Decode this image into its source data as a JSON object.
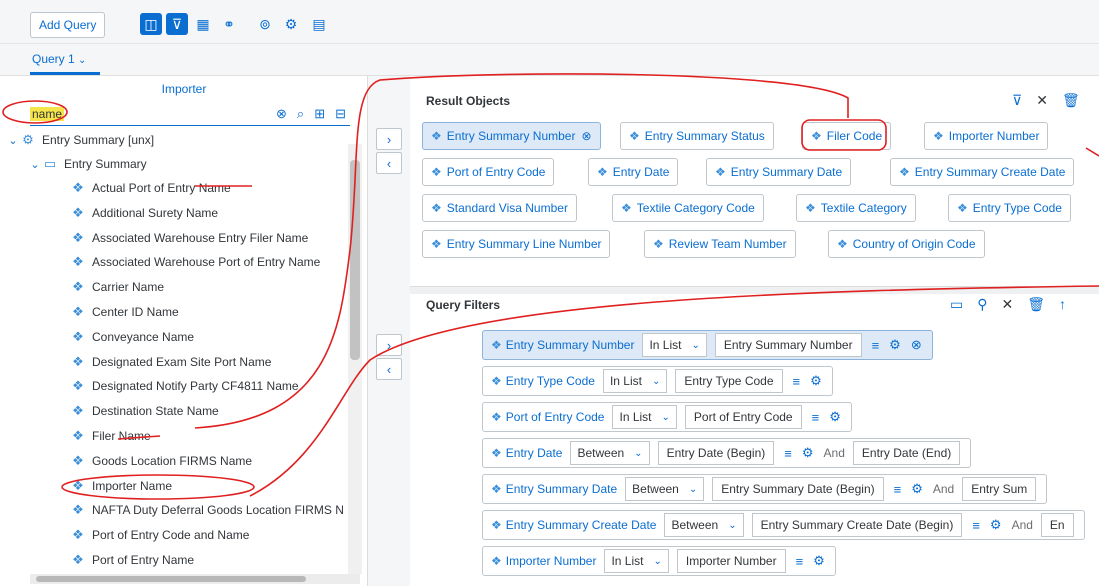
{
  "toolbar": {
    "add_query": "Add Query",
    "icons": [
      "panel-icon",
      "filter-icon",
      "table-icon",
      "group-icon",
      "link-icon",
      "settings-icon",
      "document-icon"
    ]
  },
  "tabs": {
    "active": "Query 1"
  },
  "left": {
    "title": "Importer",
    "search_value": "name",
    "root_node": "Entry Summary [unx]",
    "folder": "Entry Summary",
    "items": [
      "Actual Port of Entry Name",
      "Additional Surety Name",
      "Associated Warehouse Entry Filer Name",
      "Associated Warehouse Port of Entry Name",
      "Carrier Name",
      "Center ID Name",
      "Conveyance Name",
      "Designated Exam Site Port Name",
      "Designated Notify Party CF4811 Name",
      "Destination State Name",
      "Filer Name",
      "Goods Location FIRMS Name",
      "Importer Name",
      "NAFTA Duty Deferral Goods Location FIRMS N",
      "Port of Entry Code and Name",
      "Port of Entry Name"
    ]
  },
  "result_objects": {
    "title": "Result Objects",
    "rows": [
      [
        "Entry Summary Number",
        "Entry Summary Status",
        "Filer Code",
        "Importer Number"
      ],
      [
        "Port of Entry Code",
        "Entry Date",
        "Entry Summary Date",
        "Entry Summary Create Date"
      ],
      [
        "Standard Visa Number",
        "Textile Category Code",
        "Textile Category",
        "Entry Type Code"
      ],
      [
        "Entry Summary Line Number",
        "Review Team Number",
        "Country of Origin Code"
      ]
    ]
  },
  "query_filters": {
    "title": "Query Filters",
    "and_label": "And",
    "filters": [
      {
        "name": "Entry Summary Number",
        "op": "In List",
        "value": "Entry Summary Number",
        "value2": ""
      },
      {
        "name": "Entry Type Code",
        "op": "In List",
        "value": "Entry Type Code",
        "value2": ""
      },
      {
        "name": "Port of Entry Code",
        "op": "In List",
        "value": "Port of Entry Code",
        "value2": ""
      },
      {
        "name": "Entry Date",
        "op": "Between",
        "value": "Entry Date (Begin)",
        "value2": "Entry Date (End)"
      },
      {
        "name": "Entry Summary Date",
        "op": "Between",
        "value": "Entry Summary Date (Begin)",
        "value2": "Entry Sum"
      },
      {
        "name": "Entry Summary Create Date",
        "op": "Between",
        "value": "Entry Summary Create Date (Begin)",
        "value2": "En"
      },
      {
        "name": "Importer Number",
        "op": "In List",
        "value": "Importer Number",
        "value2": ""
      }
    ]
  }
}
